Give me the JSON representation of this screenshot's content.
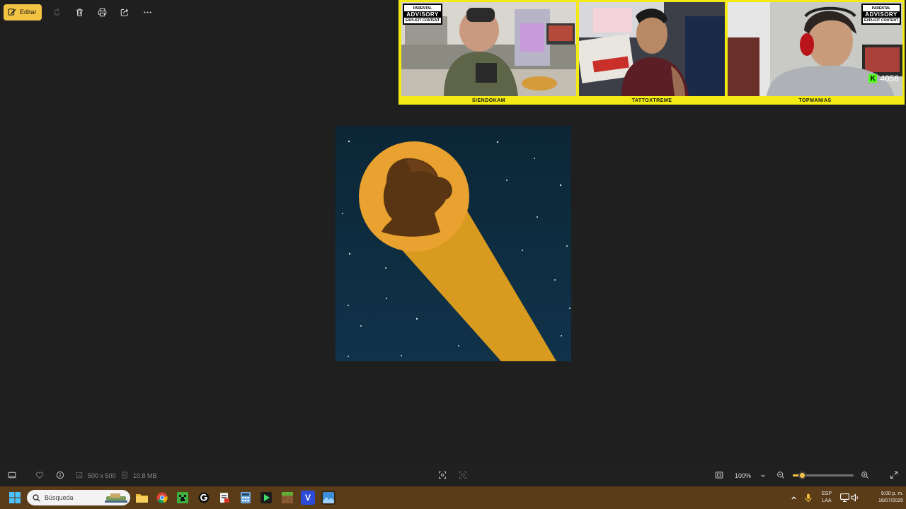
{
  "toolbar": {
    "edit_label": "Editar",
    "icons": [
      "edit-icon",
      "rotate-icon",
      "trash-icon",
      "print-icon",
      "share-icon",
      "more-icon"
    ]
  },
  "streamers": [
    {
      "name": "SIENDOKAM",
      "advisory": [
        "PARENTAL",
        "ADVISORY",
        "EXPLICIT CONTENT"
      ]
    },
    {
      "name": "TATTOXTREME"
    },
    {
      "name": "TOPMANIAS",
      "advisory": [
        "PARENTAL",
        "ADVISORY",
        "EXPLICIT CONTENT"
      ]
    }
  ],
  "viewer_badge": {
    "count": "4056",
    "icon": "kick-logo-icon",
    "color": "#53fc18"
  },
  "image": {
    "colors": {
      "sky": "#0f2a3a",
      "moon": "#e9a22f",
      "beam": "#d99b1f",
      "silhouette": "#5a3513"
    }
  },
  "statusbar": {
    "dimensions": "500 x 500",
    "file_size": "10.8 MB",
    "zoom": "100%",
    "zoom_level": 0.16
  },
  "taskbar": {
    "search_placeholder": "Búsqueda",
    "language_top": "ESP",
    "language_bottom": "LAA",
    "time": "9:00 p. m.",
    "date": "16/07/2025"
  },
  "theme": {
    "accent": "#f3c343",
    "background": "#1f1f1f",
    "taskbar": "#5a3c19"
  }
}
